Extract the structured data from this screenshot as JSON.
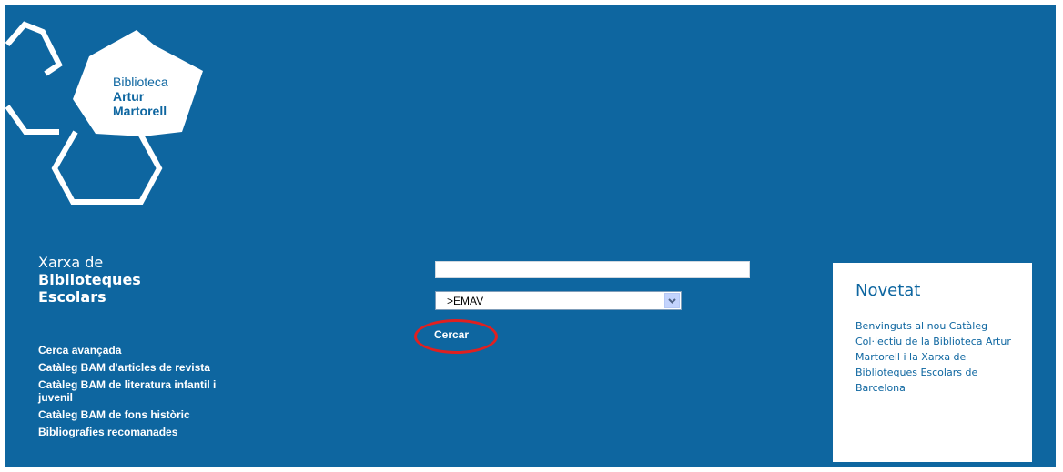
{
  "logo": {
    "line1": "Biblioteca",
    "line2": "Artur",
    "line3": "Martorell"
  },
  "network": {
    "line1": "Xarxa de",
    "line2": "Biblioteques",
    "line3": "Escolars"
  },
  "links": [
    "Cerca avançada",
    "Catàleg BAM d'articles de revista",
    "Catàleg BAM de literatura infantil i juvenil",
    "Catàleg BAM de fons històric",
    "Bibliografies recomanades"
  ],
  "search": {
    "input_value": "",
    "select_value": ">EMAV",
    "button_label": "Cercar"
  },
  "novetat": {
    "title": "Novetat",
    "body": "Benvinguts al nou Catàleg Col·lectiu de la Biblioteca Artur Martorell i la Xarxa de Biblioteques Escolars de Barcelona"
  },
  "colors": {
    "background": "#0e66a0",
    "highlight_ring": "#e02020"
  }
}
